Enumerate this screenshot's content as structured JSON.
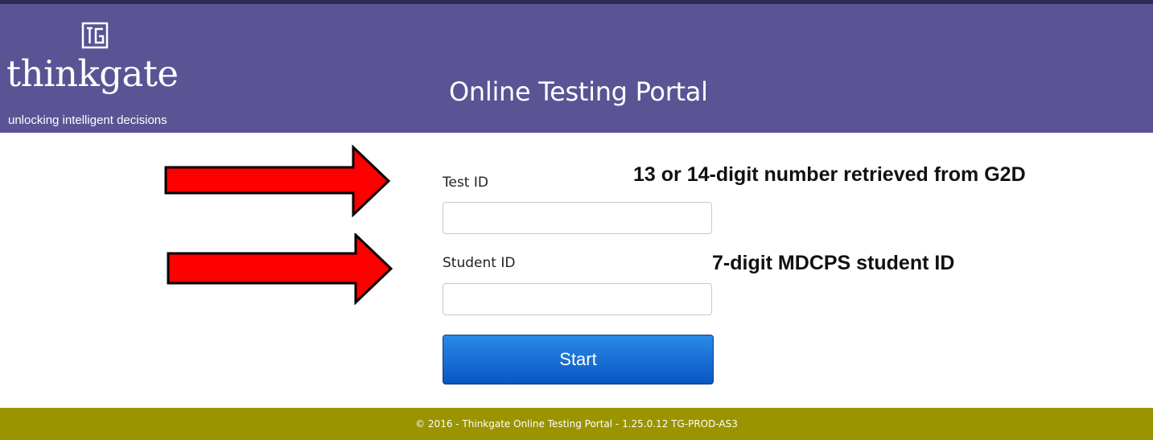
{
  "header": {
    "logo_word": "thinkgate",
    "logo_tagline": "unlocking intelligent decisions",
    "portal_title": "Online Testing Portal",
    "background": "#5a5394"
  },
  "form": {
    "test_id_label": "Test ID",
    "test_id_value": "",
    "student_id_label": "Student ID",
    "student_id_value": "",
    "start_label": "Start"
  },
  "annotations": {
    "test_id_note": "13 or 14-digit number retrieved from G2D",
    "student_id_note": "7-digit MDCPS student ID",
    "arrow_color": "#ff0000"
  },
  "footer": {
    "text": "© 2016 - Thinkgate Online Testing Portal - 1.25.0.12 TG-PROD-AS3",
    "background": "#999400"
  }
}
